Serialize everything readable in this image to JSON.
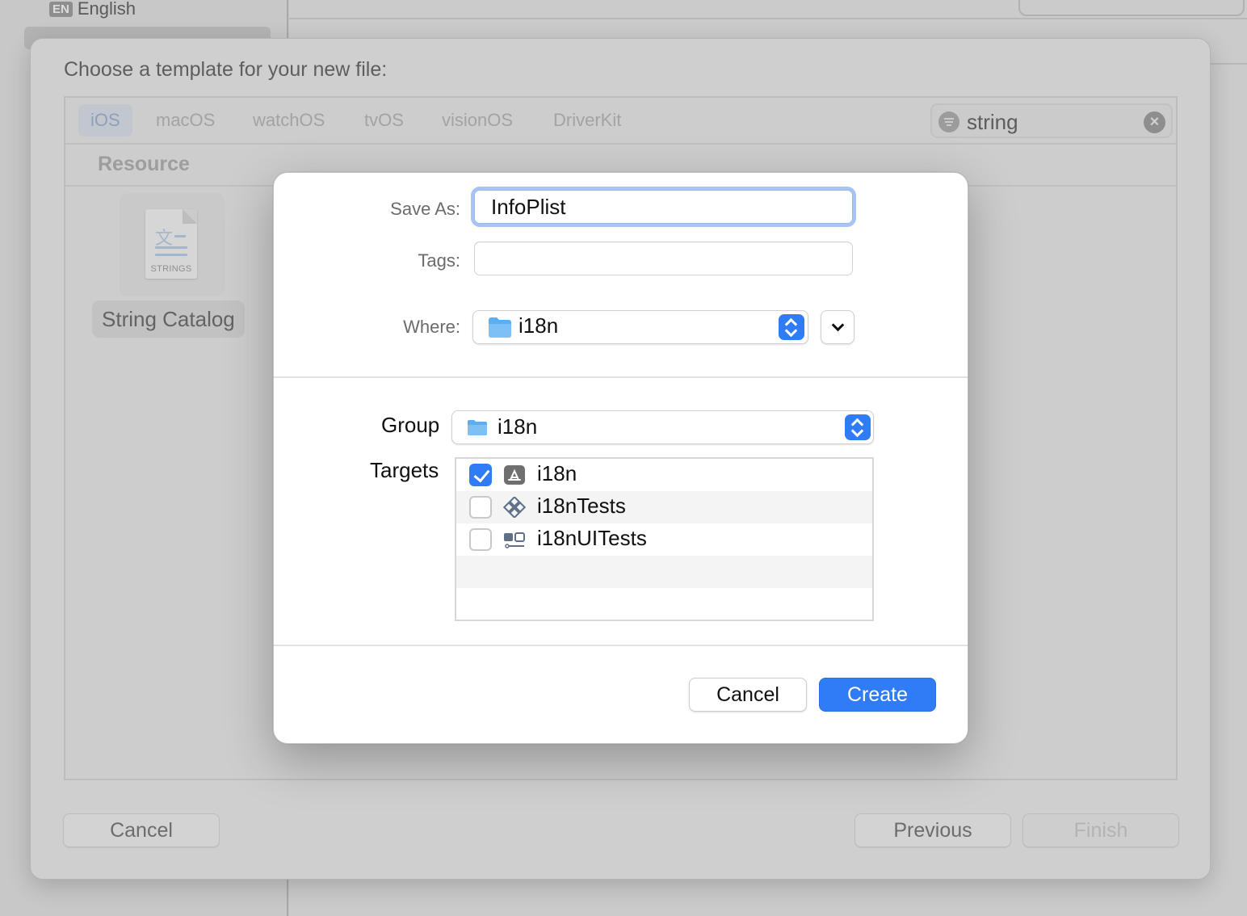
{
  "background": {
    "sidebar_language_code": "EN",
    "sidebar_language": "English"
  },
  "chooser": {
    "title": "Choose a template for your new file:",
    "platform_tabs": [
      {
        "label": "iOS",
        "selected": true
      },
      {
        "label": "macOS",
        "selected": false
      },
      {
        "label": "watchOS",
        "selected": false
      },
      {
        "label": "tvOS",
        "selected": false
      },
      {
        "label": "visionOS",
        "selected": false
      },
      {
        "label": "DriverKit",
        "selected": false
      }
    ],
    "search": {
      "value": "string"
    },
    "section_header": "Resource",
    "template": {
      "icon_label": "STRINGS",
      "name": "String Catalog",
      "icon": "strings-file-icon"
    },
    "buttons": {
      "cancel": "Cancel",
      "previous": "Previous",
      "finish": "Finish"
    }
  },
  "save_dialog": {
    "save_as": {
      "label": "Save As:",
      "value": "InfoPlist"
    },
    "tags": {
      "label": "Tags:",
      "value": ""
    },
    "where": {
      "label": "Where:",
      "value": "i18n",
      "icon": "folder-icon"
    },
    "group": {
      "label": "Group",
      "value": "i18n",
      "icon": "folder-icon"
    },
    "targets": {
      "label": "Targets",
      "items": [
        {
          "name": "i18n",
          "checked": true,
          "icon": "app-target-icon"
        },
        {
          "name": "i18nTests",
          "checked": false,
          "icon": "unit-test-target-icon"
        },
        {
          "name": "i18nUITests",
          "checked": false,
          "icon": "ui-test-target-icon"
        }
      ]
    },
    "buttons": {
      "cancel": "Cancel",
      "create": "Create"
    },
    "colors": {
      "accent": "#2f7cf6",
      "folder": "#5aaef2"
    }
  }
}
